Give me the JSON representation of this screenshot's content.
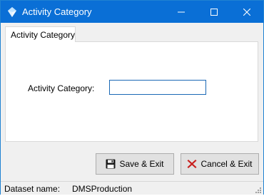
{
  "window": {
    "title": "Activity Category",
    "title_bar_color": "#0a6fd6",
    "icons": {
      "app": "app-icon",
      "minimize": "minimize-icon",
      "maximize": "maximize-icon",
      "close": "close-icon"
    }
  },
  "tabs": [
    {
      "label": "Activity Category",
      "selected": true
    }
  ],
  "form": {
    "activity_category_label": "Activity Category:",
    "activity_category_value": ""
  },
  "buttons": {
    "save": {
      "label": "Save & Exit",
      "icon": "floppy-disk-icon"
    },
    "cancel": {
      "label": "Cancel & Exit",
      "icon": "red-x-icon"
    }
  },
  "status": {
    "dataset_label": "Dataset name:",
    "dataset_value": "DMSProduction"
  }
}
